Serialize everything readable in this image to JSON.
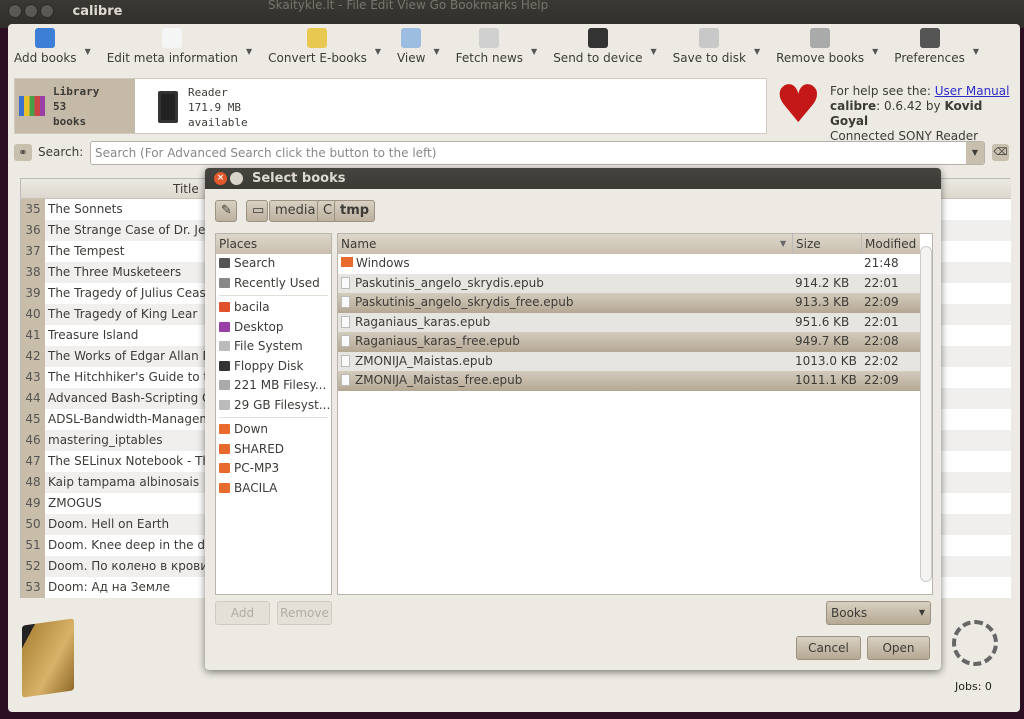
{
  "background_window": {
    "menu_text": "Skaitykle.lt - File  Edit  View  Go  Bookmarks  Help"
  },
  "window": {
    "title": "calibre"
  },
  "toolbar": [
    {
      "label": "Add books",
      "icon": "add-book-icon",
      "color": "#3d7fd6"
    },
    {
      "label": "Edit meta information",
      "icon": "edit-metadata-icon",
      "color": "#f5f5f5"
    },
    {
      "label": "Convert E-books",
      "icon": "convert-icon",
      "color": "#e8c850"
    },
    {
      "label": "View",
      "icon": "magnifier-icon",
      "color": "#9cbce0"
    },
    {
      "label": "Fetch news",
      "icon": "news-icon",
      "color": "#d0d0d0"
    },
    {
      "label": "Send to device",
      "icon": "device-icon",
      "color": "#333333"
    },
    {
      "label": "Save to disk",
      "icon": "disk-icon",
      "color": "#c8c8c8"
    },
    {
      "label": "Remove books",
      "icon": "trash-icon",
      "color": "#aaaaaa"
    },
    {
      "label": "Preferences",
      "icon": "hammer-icon",
      "color": "#555555"
    }
  ],
  "status": {
    "library": [
      "Library",
      "53",
      "books"
    ],
    "reader": [
      "Reader",
      "171.9 MB",
      "available"
    ]
  },
  "help": {
    "prefix": "For help see the: ",
    "link": "User Manual",
    "app": "calibre",
    "version": ": 0.6.42 by ",
    "author": "Kovid Goyal",
    "device": "Connected SONY Reader"
  },
  "search": {
    "label": "Search:",
    "placeholder": "Search (For Advanced Search click the button to the left)"
  },
  "books": {
    "title_header": "Title",
    "rows": [
      {
        "n": "35",
        "t": "The Sonnets"
      },
      {
        "n": "36",
        "t": "The Strange Case of Dr. Jeky"
      },
      {
        "n": "37",
        "t": "The Tempest"
      },
      {
        "n": "38",
        "t": "The Three Musketeers"
      },
      {
        "n": "39",
        "t": "The Tragedy of Julius Ceasar"
      },
      {
        "n": "40",
        "t": "The Tragedy of King Lear"
      },
      {
        "n": "41",
        "t": "Treasure Island"
      },
      {
        "n": "42",
        "t": "The Works of Edgar Allan Po"
      },
      {
        "n": "43",
        "t": "The Hitchhiker's Guide to th"
      },
      {
        "n": "44",
        "t": "Advanced Bash-Scripting Gu"
      },
      {
        "n": "45",
        "t": "ADSL-Bandwidth-Manageme"
      },
      {
        "n": "46",
        "t": "mastering_iptables"
      },
      {
        "n": "47",
        "t": "The SELinux Notebook - The"
      },
      {
        "n": "48",
        "t": "Kaip tampama albinosais"
      },
      {
        "n": "49",
        "t": "ZMOGUS"
      },
      {
        "n": "50",
        "t": "Doom. Hell on Earth"
      },
      {
        "n": "51",
        "t": "Doom. Knee deep in the de"
      },
      {
        "n": "52",
        "t": "Doom. По колено в крови"
      },
      {
        "n": "53",
        "t": "Doom: Ад на Земле"
      }
    ]
  },
  "jobs": "Jobs: 0",
  "dialog": {
    "title": "Select books",
    "path": [
      "media",
      "C",
      "tmp"
    ],
    "places_header": "Places",
    "places": [
      {
        "label": "Search",
        "icon": "search-icon",
        "color": "#555555"
      },
      {
        "label": "Recently Used",
        "icon": "clock-icon",
        "color": "#888888"
      },
      {
        "sep": true
      },
      {
        "label": "bacila",
        "icon": "home-folder-icon",
        "color": "#e0502a"
      },
      {
        "label": "Desktop",
        "icon": "desktop-icon",
        "color": "#9b3fa8"
      },
      {
        "label": "File System",
        "icon": "harddisk-icon",
        "color": "#bbbbbb"
      },
      {
        "label": "Floppy Disk",
        "icon": "floppy-icon",
        "color": "#333333"
      },
      {
        "label": "221 MB Filesy...",
        "icon": "usb-icon",
        "color": "#aaaaaa"
      },
      {
        "label": "29 GB Filesyst...",
        "icon": "harddisk-icon",
        "color": "#bbbbbb"
      },
      {
        "sep": true
      },
      {
        "label": "Down",
        "icon": "folder-icon",
        "color": "#e86a2c"
      },
      {
        "label": "SHARED",
        "icon": "folder-icon",
        "color": "#e86a2c"
      },
      {
        "label": "PC-MP3",
        "icon": "folder-icon",
        "color": "#e86a2c"
      },
      {
        "label": "BACILA",
        "icon": "folder-icon",
        "color": "#e86a2c"
      }
    ],
    "columns": [
      "Name",
      "Size",
      "Modified"
    ],
    "files": [
      {
        "name": "Windows",
        "size": "",
        "modified": "21:48",
        "type": "folder",
        "selected": false
      },
      {
        "name": "Paskutinis_angelo_skrydis.epub",
        "size": "914.2 KB",
        "modified": "22:01",
        "type": "file",
        "selected": false
      },
      {
        "name": "Paskutinis_angelo_skrydis_free.epub",
        "size": "913.3 KB",
        "modified": "22:09",
        "type": "file",
        "selected": true
      },
      {
        "name": "Raganiaus_karas.epub",
        "size": "951.6 KB",
        "modified": "22:01",
        "type": "file",
        "selected": false
      },
      {
        "name": "Raganiaus_karas_free.epub",
        "size": "949.7 KB",
        "modified": "22:08",
        "type": "file",
        "selected": true
      },
      {
        "name": "ZMONIJA_Maistas.epub",
        "size": "1013.0 KB",
        "modified": "22:02",
        "type": "file",
        "selected": false
      },
      {
        "name": "ZMONIJA_Maistas_free.epub",
        "size": "1011.1 KB",
        "modified": "22:09",
        "type": "file",
        "selected": true
      }
    ],
    "add": "Add",
    "remove": "Remove",
    "filter": "Books",
    "cancel": "Cancel",
    "open": "Open"
  }
}
